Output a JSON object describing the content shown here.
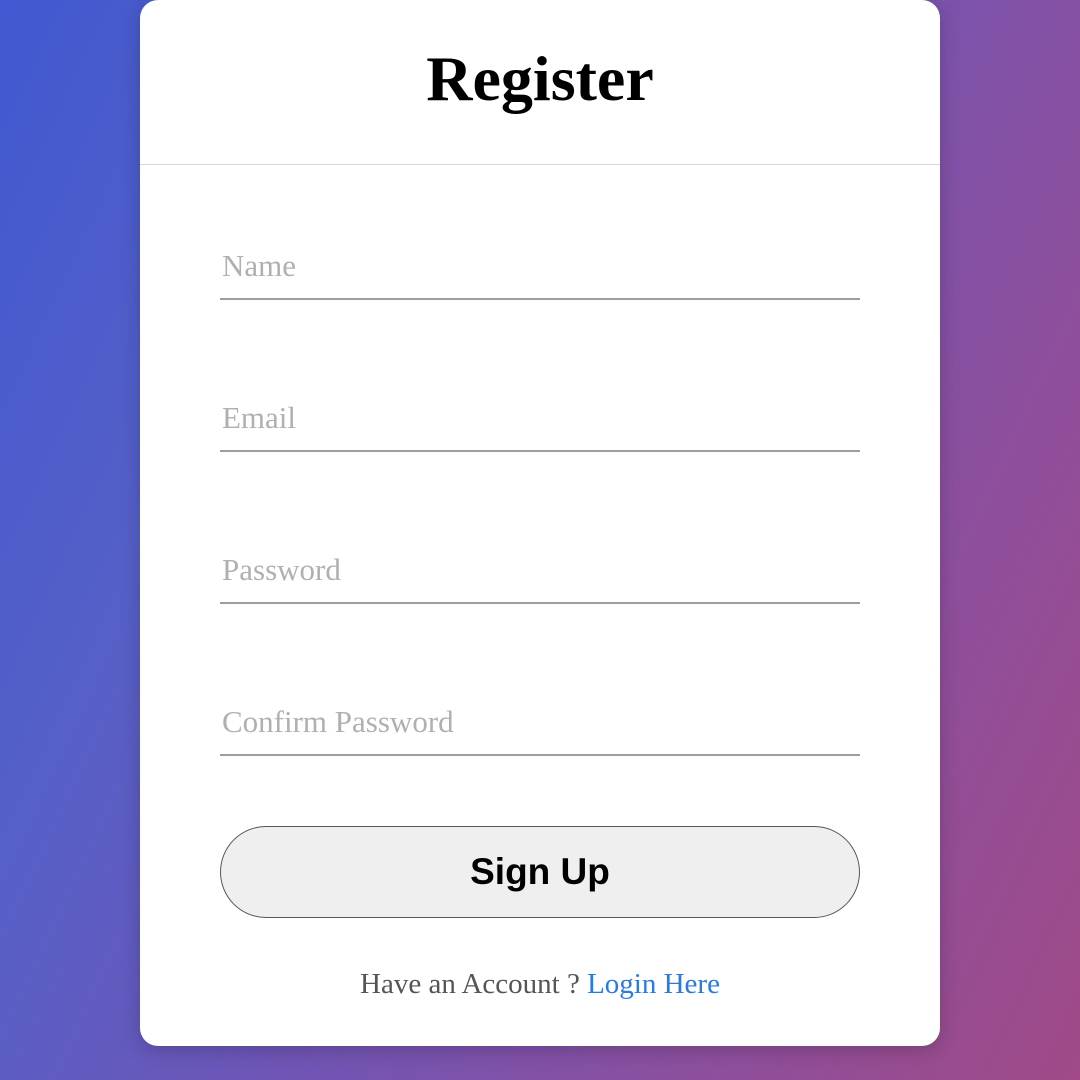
{
  "card": {
    "title": "Register",
    "fields": {
      "name": {
        "placeholder": "Name",
        "value": ""
      },
      "email": {
        "placeholder": "Email",
        "value": ""
      },
      "password": {
        "placeholder": "Password",
        "value": ""
      },
      "confirm_password": {
        "placeholder": "Confirm Password",
        "value": ""
      }
    },
    "submit_label": "Sign Up",
    "footer": {
      "prompt": "Have an Account ? ",
      "link_text": "Login Here"
    }
  }
}
